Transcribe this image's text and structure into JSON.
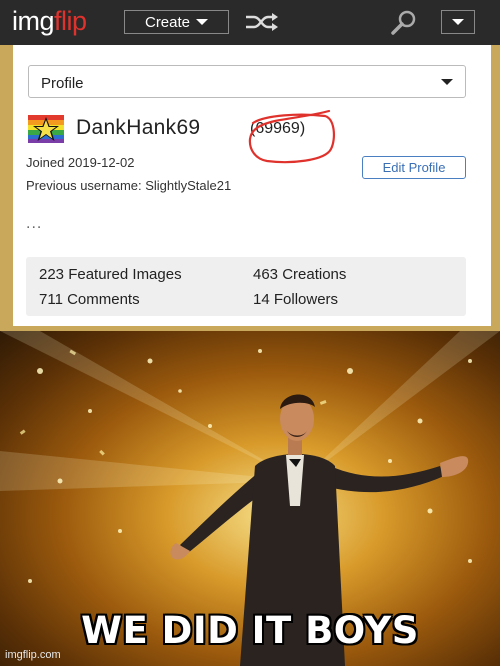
{
  "site": {
    "logo_part1": "img",
    "logo_part2": "flip",
    "create_label": "Create"
  },
  "profile": {
    "select_value": "Profile",
    "username": "DankHank69",
    "points": "(69969)",
    "joined": "Joined 2019-12-02",
    "previous_username": "Previous username: SlightlyStale21",
    "edit_label": "Edit Profile",
    "more": "...",
    "stats": [
      "223 Featured Images",
      "463 Creations",
      "711 Comments",
      "14 Followers"
    ]
  },
  "meme": {
    "caption": "WE DID IT BOYS",
    "watermark": "imgflip.com"
  },
  "colors": {
    "topbar": "#2a2a2a",
    "logo_accent": "#e0322d",
    "circle": "#e0322d",
    "edit_button": "#3a6fb5"
  },
  "icons": [
    "chevron-down-icon",
    "shuffle-icon",
    "search-icon",
    "rainbow-star-flag-icon"
  ]
}
